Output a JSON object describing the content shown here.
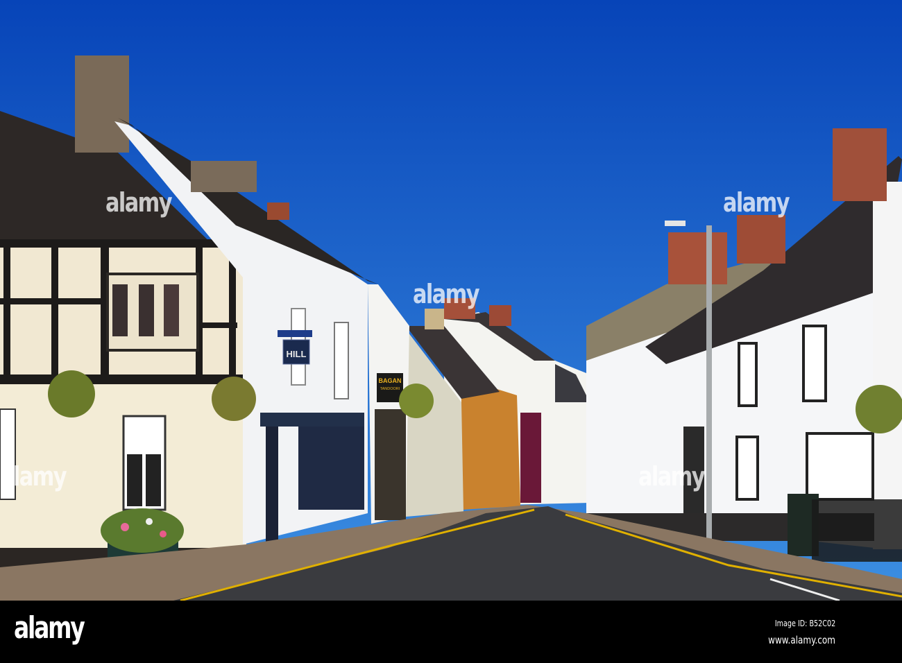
{
  "photo": {
    "signs": {
      "hill_sign": "HILL",
      "bagan_sign_title": "BAGAN",
      "bagan_sign_subtitle": "TANDOORI"
    },
    "watermark": "alamy"
  },
  "footer": {
    "logo": "alamy",
    "image_id": "Image ID: B52C02",
    "url": "www.alamy.com"
  },
  "colors": {
    "sky": "#0c4fc2",
    "footer": "#000000",
    "road_line": "#e0b000"
  }
}
